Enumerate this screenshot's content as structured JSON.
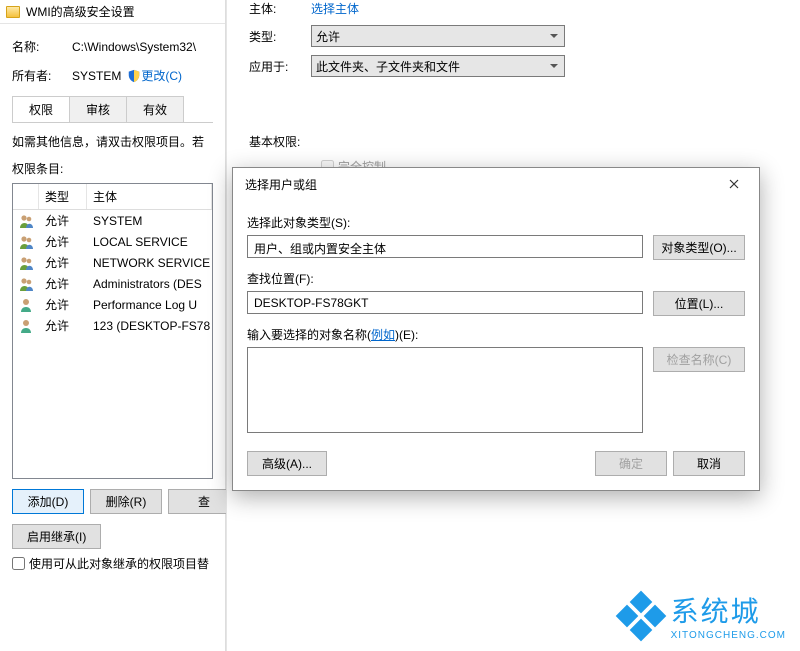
{
  "win1": {
    "title": "WMI的高级安全设置",
    "name_label": "名称:",
    "name_value": "C:\\Windows\\System32\\",
    "owner_label": "所有者:",
    "owner_value": "SYSTEM",
    "change_link": "更改(C)",
    "tabs": {
      "perm": "权限",
      "audit": "审核",
      "valid": "有效"
    },
    "info": "如需其他信息，请双击权限项目。若",
    "entries_label": "权限条目:",
    "cols": {
      "type": "类型",
      "principal": "主体"
    },
    "rows": [
      {
        "type": "允许",
        "principal": "SYSTEM"
      },
      {
        "type": "允许",
        "principal": "LOCAL SERVICE"
      },
      {
        "type": "允许",
        "principal": "NETWORK SERVICE"
      },
      {
        "type": "允许",
        "principal": "Administrators (DES"
      },
      {
        "type": "允许",
        "principal": "Performance Log U"
      },
      {
        "type": "允许",
        "principal": "123 (DESKTOP-FS78"
      }
    ],
    "btn_add": "添加(D)",
    "btn_remove": "删除(R)",
    "btn_view": "查",
    "btn_enable_inherit": "启用继承(I)",
    "chk_replace": "使用可从此对象继承的权限项目替"
  },
  "win2": {
    "principal_label": "主体:",
    "principal_link": "选择主体",
    "type_label": "类型:",
    "type_value": "允许",
    "applies_label": "应用于:",
    "applies_value": "此文件夹、子文件夹和文件",
    "basic_label": "基本权限:",
    "full_control": "完全控制"
  },
  "win3": {
    "title": "选择用户或组",
    "obj_type_label": "选择此对象类型(S):",
    "obj_type_value": "用户、组或内置安全主体",
    "btn_obj_type": "对象类型(O)...",
    "loc_label": "查找位置(F):",
    "loc_value": "DESKTOP-FS78GKT",
    "btn_loc": "位置(L)...",
    "names_label_pre": "输入要选择的对象名称(",
    "names_label_link": "例如",
    "names_label_post": ")(E):",
    "btn_check": "检查名称(C)",
    "btn_adv": "高级(A)...",
    "btn_ok": "确定",
    "btn_cancel": "取消"
  },
  "watermark": {
    "big": "系统城",
    "small": "XITONGCHENG.COM"
  }
}
